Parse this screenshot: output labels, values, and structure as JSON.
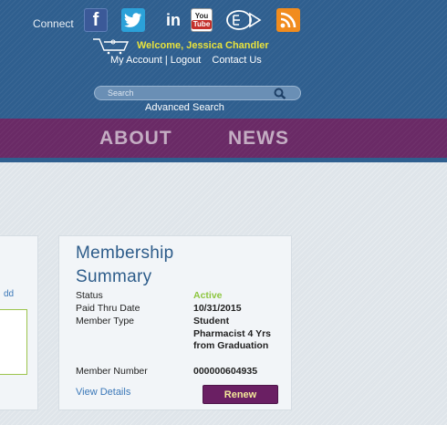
{
  "header": {
    "connect_label": "Connect",
    "social_icons": [
      "facebook-icon",
      "twitter-icon",
      "linkedin-icon",
      "youtube-icon",
      "podcast-icon",
      "rss-icon"
    ],
    "facebook_glyph": "f",
    "linkedin_glyph": "in",
    "youtube_top": "You",
    "youtube_bottom": "Tube",
    "welcome": "Welcome, Jessica Chandler",
    "my_account": "My Account",
    "separator": "|",
    "logout": "Logout",
    "contact_us": "Contact Us",
    "search_placeholder": "Search",
    "advanced_search": "Advanced Search"
  },
  "nav": {
    "items": [
      {
        "label": "ABOUT"
      },
      {
        "label": "NEWS"
      }
    ]
  },
  "left_panel": {
    "link_text": "dd"
  },
  "membership": {
    "title": "Membership Summary",
    "rows": [
      {
        "label": "Status",
        "value": "Active"
      },
      {
        "label": "Paid Thru Date",
        "value": "10/31/2015"
      },
      {
        "label": "Member Type",
        "value": "Student Pharmacist 4 Yrs from Graduation"
      },
      {
        "label": "Member Number",
        "value": "000000604935"
      }
    ],
    "view_details": "View Details",
    "renew_label": "Renew"
  },
  "colors": {
    "header_blue": "#2f5f8f",
    "nav_purple": "#6a2a66",
    "welcome_yellow": "#e8e23c",
    "status_green": "#8dc63f",
    "renew_bg": "#6a1f63",
    "link_blue": "#3b78b8"
  }
}
